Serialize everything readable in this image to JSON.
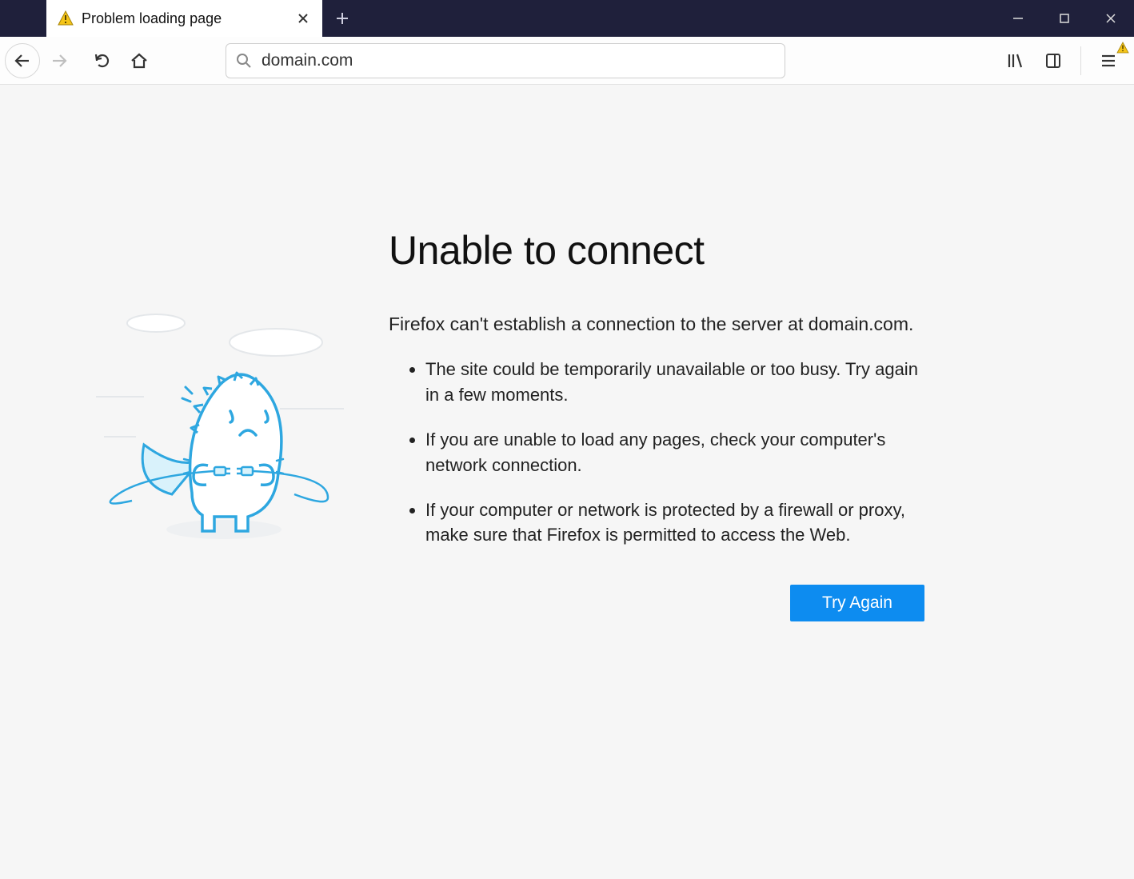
{
  "tab": {
    "title": "Problem loading page"
  },
  "urlbar": {
    "value": "domain.com"
  },
  "error": {
    "title": "Unable to connect",
    "subtitle": "Firefox can't establish a connection to the server at domain.com.",
    "bullets": [
      "The site could be temporarily unavailable or too busy. Try again in a few moments.",
      "If you are unable to load any pages, check your computer's network connection.",
      "If your computer or network is protected by a firewall or proxy, make sure that Firefox is permitted to access the Web."
    ],
    "try_again_label": "Try Again"
  }
}
